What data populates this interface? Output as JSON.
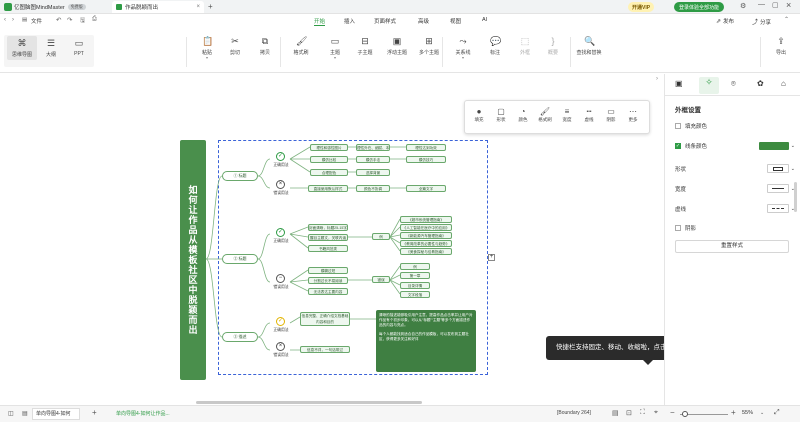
{
  "app": {
    "name": "亿图脑图MindMaster",
    "badge": "免费版",
    "doc_tab": "作品脱颖而出"
  },
  "titlebar_right": {
    "vip": "开通VIP",
    "login": "登录体验全部功能"
  },
  "menu": {
    "file": "文件",
    "tabs": [
      "开始",
      "插入",
      "页面样式",
      "高级",
      "视图",
      "AI"
    ],
    "active": "开始",
    "publish": "发布",
    "share": "分享"
  },
  "views": [
    {
      "label": "思维导图"
    },
    {
      "label": "大纲"
    },
    {
      "label": "PPT"
    }
  ],
  "ribbon": [
    {
      "label": "粘贴",
      "icon": "paste-icon",
      "glyph": "📋",
      "dd": true
    },
    {
      "label": "剪切",
      "icon": "cut-icon",
      "glyph": "✂",
      "dd": false
    },
    {
      "label": "拷贝",
      "icon": "copy-icon",
      "glyph": "⧉",
      "dd": false
    },
    {
      "label": "格式刷",
      "icon": "format-brush-icon",
      "glyph": "🖌",
      "dd": false
    },
    {
      "label": "主题",
      "icon": "topic-icon",
      "glyph": "▭",
      "dd": true
    },
    {
      "label": "子主题",
      "icon": "subtopic-icon",
      "glyph": "⊟",
      "dd": false
    },
    {
      "label": "浮动主题",
      "icon": "floating-topic-icon",
      "glyph": "▣",
      "dd": false
    },
    {
      "label": "多个主题",
      "icon": "multi-topic-icon",
      "glyph": "⊞",
      "dd": false
    },
    {
      "label": "关系线",
      "icon": "relation-icon",
      "glyph": "⤳",
      "dd": true
    },
    {
      "label": "标注",
      "icon": "callout-icon",
      "glyph": "💬",
      "dd": false
    },
    {
      "label": "外框",
      "icon": "boundary-icon",
      "glyph": "⬚",
      "dd": false
    },
    {
      "label": "概要",
      "icon": "summary-icon",
      "glyph": "}",
      "dd": false
    },
    {
      "label": "查找和替换",
      "icon": "find-replace-icon",
      "glyph": "🔍",
      "dd": false
    },
    {
      "label": "导出",
      "icon": "export-icon",
      "glyph": "⇪",
      "dd": false
    }
  ],
  "float_toolbar": [
    "填充",
    "形状",
    "颜色",
    "格式刷",
    "宽度",
    "虚线",
    "阴影",
    "更多"
  ],
  "mindmap": {
    "root": "如何让作品从模板社区中脱颖而出",
    "branches": [
      {
        "label": "① 标题"
      },
      {
        "label": "② 标题"
      },
      {
        "label": "③ 描述"
      }
    ],
    "sub": [
      "正确用法",
      "错误用法",
      "正确用法",
      "错误用法",
      "正确用法",
      "错误用法"
    ],
    "b1_nodes": [
      "理性和感性图片",
      "理性外在、细腻、本质论",
      "理性达到功效",
      "模仿比较",
      "模仿手法",
      "模仿技巧",
      "合理配色",
      "选择背景",
      "直接使用默认样式",
      "颜色不协调",
      "全篇文字"
    ],
    "b2_nodes": [
      "封面清晰，标题25-15字",
      "醒目主题文，关联内涵",
      "书籍风范类",
      "《超市系统管理指南》",
      "《人工智能在医疗中的应用》",
      "《新能源汽车管理指南》",
      "《教育改革的必要性与趋势》",
      "《美食探秘与佳肴指南》",
      "模糊过短",
      "分割过长不易阅读",
      "无法表达主要内容",
      "错误",
      "第一章",
      "目录详情",
      "文字段落",
      "思维导图"
    ],
    "b3_nodes": [
      "信息完整、正确介绍文档基础内容和目的",
      "信息不详，一句话带过"
    ],
    "b3_note1": "清晰的描述能够吸引用户注意，提高作品点击率并让用户对作品有个初步印象，可以从“标题”“主题”等多个方面描述作品的内容与亮点。",
    "b3_note2": "每个人都能找到适合自己的作品模板，可以发布到主题社区，获得更多关注和好评",
    "tag": "例"
  },
  "tooltip": "快捷栏支持固定、移动、收缩啦，点击体验一下吧~",
  "panel": {
    "title": "外框设置",
    "fill": "填充颜色",
    "line": "线条颜色",
    "shape": "形状",
    "width": "宽度",
    "dash": "虚线",
    "shadow": "阴影",
    "reset": "重置样式",
    "line_color": "#3d8b40"
  },
  "status": {
    "page": "单向导图4-如何",
    "add": "+",
    "doc": "单向导图4-如何让作品...",
    "boundary": "[Boundary 264]",
    "zoom": "55%"
  }
}
